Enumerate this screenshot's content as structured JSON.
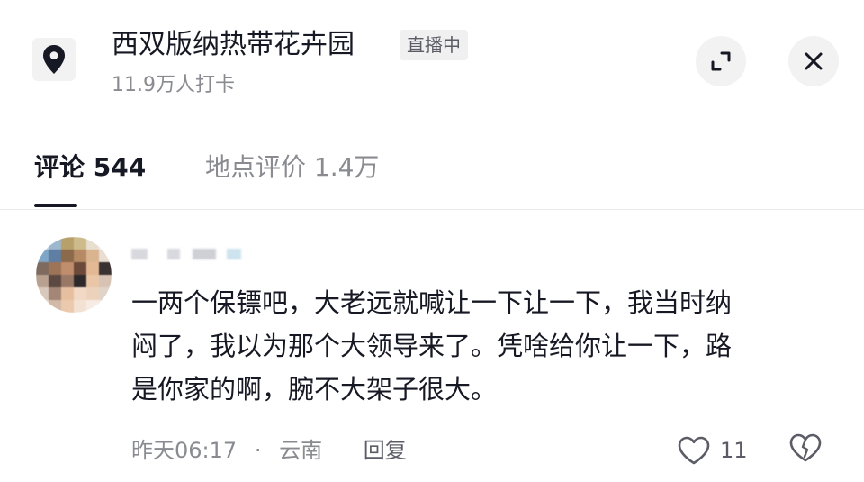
{
  "header": {
    "place_title": "西双版纳热带花卉园",
    "live_badge": "直播中",
    "checkins": "11.9万人打卡",
    "icons": {
      "location": "location-pin-icon",
      "expand": "expand-icon",
      "close": "close-icon"
    }
  },
  "tabs": [
    {
      "label": "评论 544",
      "active": true
    },
    {
      "label": "地点评价 1.4万",
      "active": false
    }
  ],
  "comment": {
    "text": "一两个保镖吧，大老远就喊让一下让一下，我当时纳\n闷了，我以为那个大领导来了。凭啥给你让一下，路\n是你家的啊，腕不大架子很大。",
    "time": "昨天06:17",
    "separator": "·",
    "location": "云南",
    "reply_label": "回复",
    "like_count": "11"
  },
  "colors": {
    "text_primary": "#161823",
    "text_secondary": "#8a8b91",
    "button_bg": "#f2f2f3"
  }
}
